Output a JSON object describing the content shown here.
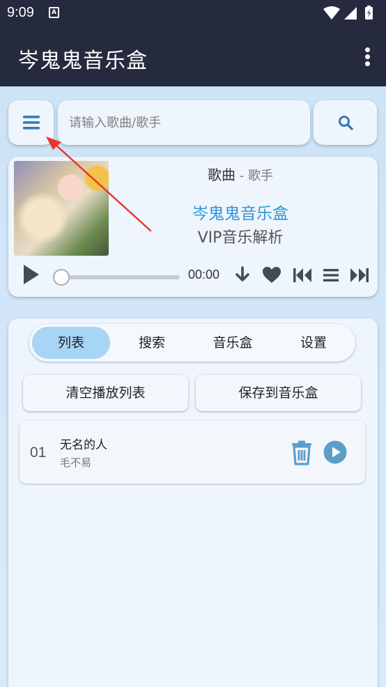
{
  "status": {
    "time": "9:09",
    "sim_label": "A"
  },
  "app": {
    "title": "岑鬼鬼音乐盒"
  },
  "search": {
    "placeholder": "请输入歌曲/歌手",
    "value": ""
  },
  "player": {
    "song": "歌曲",
    "separator": " - ",
    "artist": "歌手",
    "brand": "岑鬼鬼音乐盒",
    "slogan": "VIP音乐解析",
    "time": "00:00",
    "progress": 0
  },
  "tabs": [
    {
      "label": "列表",
      "active": true
    },
    {
      "label": "搜索",
      "active": false
    },
    {
      "label": "音乐盒",
      "active": false
    },
    {
      "label": "设置",
      "active": false
    }
  ],
  "actions": {
    "clear_label": "清空播放列表",
    "save_label": "保存到音乐盒"
  },
  "playlist": [
    {
      "index": "01",
      "title": "无名的人",
      "artist": "毛不易"
    }
  ],
  "colors": {
    "appbar": "#262a3e",
    "accent": "#2f97dc",
    "icon": "#3a78b8",
    "arrow": "#e8362e",
    "active_tab": "#a8d4f6"
  }
}
